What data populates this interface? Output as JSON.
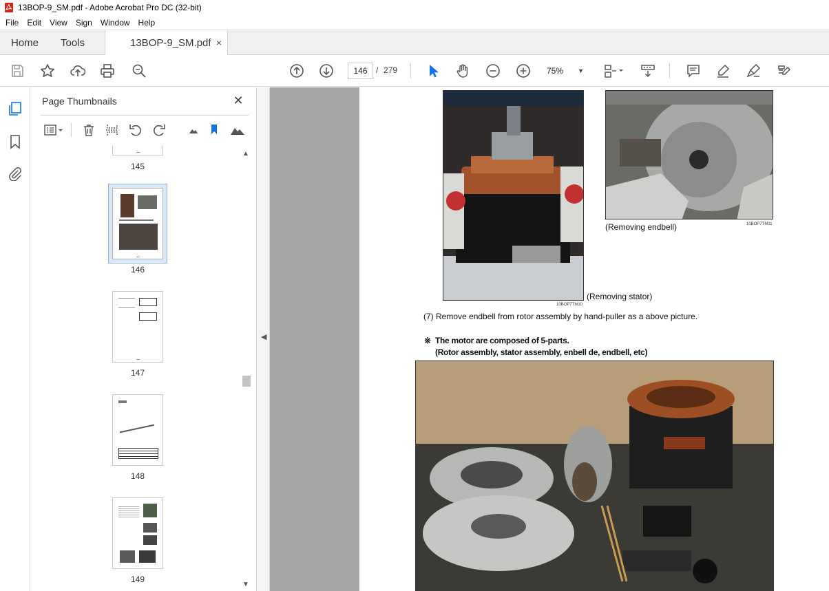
{
  "window": {
    "title": "13BOP-9_SM.pdf - Adobe Acrobat Pro DC (32-bit)"
  },
  "menu": [
    "File",
    "Edit",
    "View",
    "Sign",
    "Window",
    "Help"
  ],
  "tabs": {
    "home": "Home",
    "tools": "Tools",
    "document": "13BOP-9_SM.pdf",
    "close": "×"
  },
  "toolbar": {
    "page_current": "146",
    "page_sep": "/",
    "page_total": "279",
    "zoom": "75%"
  },
  "thumbnails": {
    "title": "Page Thumbnails",
    "close": "✕",
    "pages": [
      "145",
      "146",
      "147",
      "148",
      "149"
    ],
    "selected": "146"
  },
  "document": {
    "caption_stator": "(Removing stator)",
    "caption_endbell": "(Removing endbell)",
    "code_left": "10BOP7TM10",
    "code_right": "10BOP7TM11",
    "step7": "(7)  Remove endbell from rotor assembly by hand-puller as a above picture.",
    "note_mark": "※",
    "note_line1": "The motor are composed of 5-parts.",
    "note_line2": "(Rotor assembly, stator assembly, enbell de, endbell, etc)"
  },
  "colors": {
    "accent": "#1473e6",
    "panel_bg": "#f0f0f0",
    "doc_gray": "#a7a7a7",
    "thumb_selected": "#dbe8f6"
  },
  "icons": [
    "save-icon",
    "star-icon",
    "upload-icon",
    "print-icon",
    "zoom-search-icon",
    "page-up-icon",
    "page-down-icon",
    "select-arrow-icon",
    "hand-icon",
    "zoom-out-icon",
    "zoom-in-icon",
    "page-fit-icon",
    "scroll-icon",
    "comment-icon",
    "highlight-icon",
    "sign-icon",
    "redact-icon"
  ]
}
